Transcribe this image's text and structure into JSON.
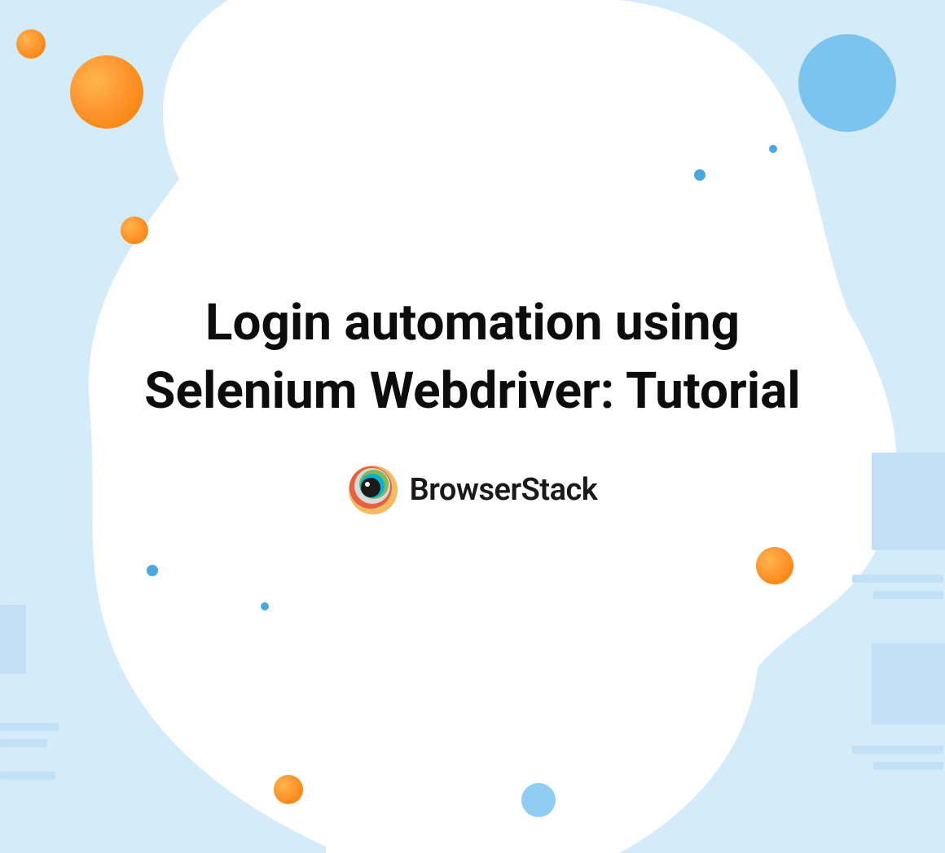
{
  "title": "Login automation using Selenium Webdriver: Tutorial",
  "brand": {
    "name": "BrowserStack"
  }
}
